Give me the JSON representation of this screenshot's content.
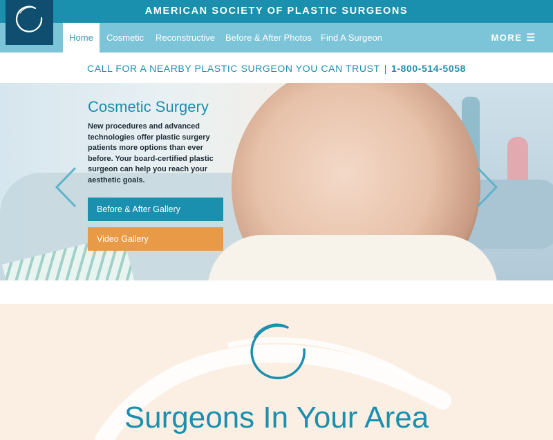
{
  "site": {
    "title": "AMERICAN SOCIETY OF PLASTIC SURGEONS"
  },
  "logo": {
    "icon": "circle-swoosh-logo"
  },
  "nav": {
    "items": [
      {
        "label": "Home",
        "active": true
      },
      {
        "label": "Cosmetic",
        "active": false
      },
      {
        "label": "Reconstructive",
        "active": false
      },
      {
        "label": "Before & After Photos",
        "active": false
      },
      {
        "label": "Find A Surgeon",
        "active": false
      }
    ],
    "more_label": "MORE",
    "more_icon": "hamburger-icon"
  },
  "callbar": {
    "text": "CALL FOR A NEARBY PLASTIC SURGEON YOU CAN TRUST",
    "separator": "|",
    "phone": "1-800-514-5058"
  },
  "hero": {
    "title": "Cosmetic Surgery",
    "text": "New procedures and advanced technologies offer plastic surgery patients more options than ever before. Your board-certified plastic surgeon can help you reach your aesthetic goals.",
    "buttons": {
      "gallery": "Before & After Gallery",
      "video": "Video Gallery"
    },
    "prev_icon": "chevron-left-icon",
    "next_icon": "chevron-right-icon"
  },
  "section": {
    "title": "Surgeons In Your Area"
  },
  "colors": {
    "primary": "#1a8fae",
    "nav": "#7cc4d7",
    "logo_bg": "#0f4e6e",
    "accent": "#e99a47",
    "section_bg": "#fbefe3"
  }
}
